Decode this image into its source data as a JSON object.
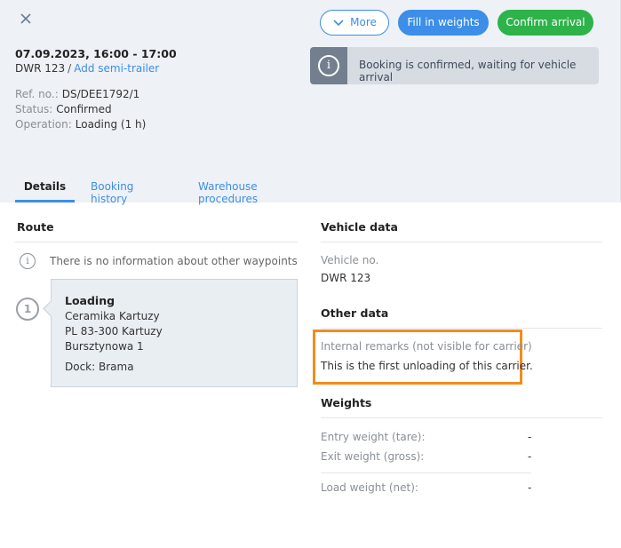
{
  "header": {
    "close_icon": "close-icon",
    "buttons": {
      "more": "More",
      "fill_weights": "Fill in weights",
      "confirm_arrival": "Confirm arrival"
    },
    "date_time": "07.09.2023, 16:00 - 17:00",
    "plate": "DWR 123",
    "plate_separator": "/",
    "add_semi_trailer": "Add semi-trailer",
    "ref_label": "Ref. no.:",
    "ref_value": "DS/DEE1792/1",
    "status_label": "Status:",
    "status_value": "Confirmed",
    "operation_label": "Operation:",
    "operation_value": "Loading (1 h)",
    "status_message": "Booking is confirmed, waiting for vehicle arrival",
    "info_icon": "i"
  },
  "tabs": [
    {
      "label": "Details",
      "active": true
    },
    {
      "label": "Booking history",
      "active": false
    },
    {
      "label": "Warehouse procedures",
      "active": false
    }
  ],
  "route": {
    "title": "Route",
    "no_waypoints_info": "There is no information about other waypoints",
    "waypoint": {
      "number": "1",
      "type": "Loading",
      "company": "Ceramika Kartuzy",
      "postal": "PL 83-300 Kartuzy",
      "street": "Bursztynowa 1",
      "dock": "Dock: Brama"
    }
  },
  "vehicle": {
    "title": "Vehicle data",
    "vehicle_no_label": "Vehicle no.",
    "vehicle_no_value": "DWR 123"
  },
  "other": {
    "title": "Other data",
    "remarks_label": "Internal remarks (not visible for carrier)",
    "remarks_value": "This is the first unloading of this carrier."
  },
  "weights": {
    "title": "Weights",
    "rows": [
      {
        "label": "Entry weight (tare):",
        "value": "-"
      },
      {
        "label": "Exit weight (gross):",
        "value": "-"
      },
      {
        "label": "Load weight (net):",
        "value": "-"
      }
    ]
  },
  "colors": {
    "accent_blue": "#3d8ee8",
    "confirm_green": "#2db34a",
    "highlight_orange": "#f28c1c"
  }
}
